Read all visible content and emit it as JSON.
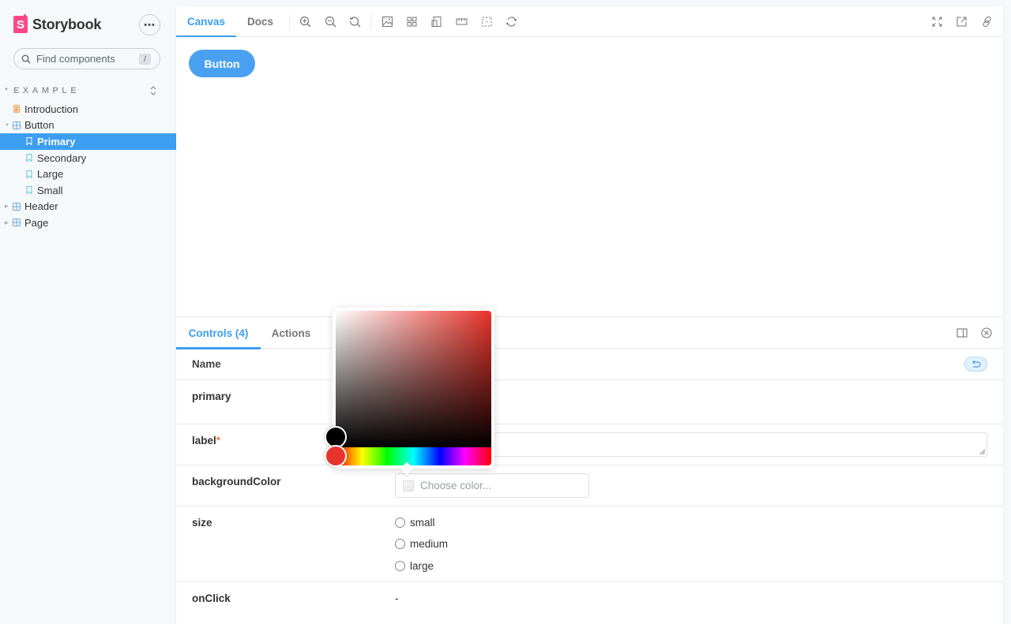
{
  "brand": {
    "name": "Storybook",
    "logo_letter": "S",
    "accent": "#ff4785"
  },
  "sidebar": {
    "menu_button": "•••",
    "search": {
      "placeholder": "Find components",
      "shortcut": "/"
    },
    "section": "EXAMPLE",
    "items": [
      {
        "label": "Introduction",
        "type": "document",
        "level": 1
      },
      {
        "label": "Button",
        "type": "component",
        "level": 1,
        "expanded": true
      },
      {
        "label": "Primary",
        "type": "story",
        "level": 2,
        "selected": true
      },
      {
        "label": "Secondary",
        "type": "story",
        "level": 2
      },
      {
        "label": "Large",
        "type": "story",
        "level": 2
      },
      {
        "label": "Small",
        "type": "story",
        "level": 2
      },
      {
        "label": "Header",
        "type": "component",
        "level": 1,
        "expanded": false
      },
      {
        "label": "Page",
        "type": "component",
        "level": 1,
        "expanded": false
      }
    ]
  },
  "toolbar": {
    "tabs": [
      {
        "label": "Canvas",
        "active": true
      },
      {
        "label": "Docs",
        "active": false
      }
    ],
    "tools": [
      "zoom-in-icon",
      "zoom-out-icon",
      "zoom-reset-icon",
      "background-icon",
      "grid-icon",
      "viewport-icon",
      "measure-icon",
      "outline-icon",
      "remount-icon"
    ],
    "right_tools": [
      "fullscreen-icon",
      "open-new-tab-icon",
      "copy-link-icon"
    ]
  },
  "canvas": {
    "button_label": "Button",
    "button_color": "#4aa0f0"
  },
  "addons": {
    "tabs": [
      {
        "label": "Controls (4)",
        "active": true
      },
      {
        "label": "Actions",
        "active": false
      }
    ],
    "header": {
      "name": "Name"
    },
    "controls": [
      {
        "name": "primary",
        "required": false
      },
      {
        "name": "label",
        "required": true,
        "required_mark": "*",
        "value": ""
      },
      {
        "name": "backgroundColor",
        "required": false,
        "placeholder": "Choose color..."
      },
      {
        "name": "size",
        "required": false,
        "options": [
          "small",
          "medium",
          "large"
        ]
      },
      {
        "name": "onClick",
        "required": false,
        "value": "-"
      }
    ]
  },
  "color_picker": {
    "hue_color": "#e8332a",
    "selected_color": "#000000"
  },
  "colors": {
    "accent": "#3c9ef2",
    "selected_bg": "#3c9ef2"
  }
}
